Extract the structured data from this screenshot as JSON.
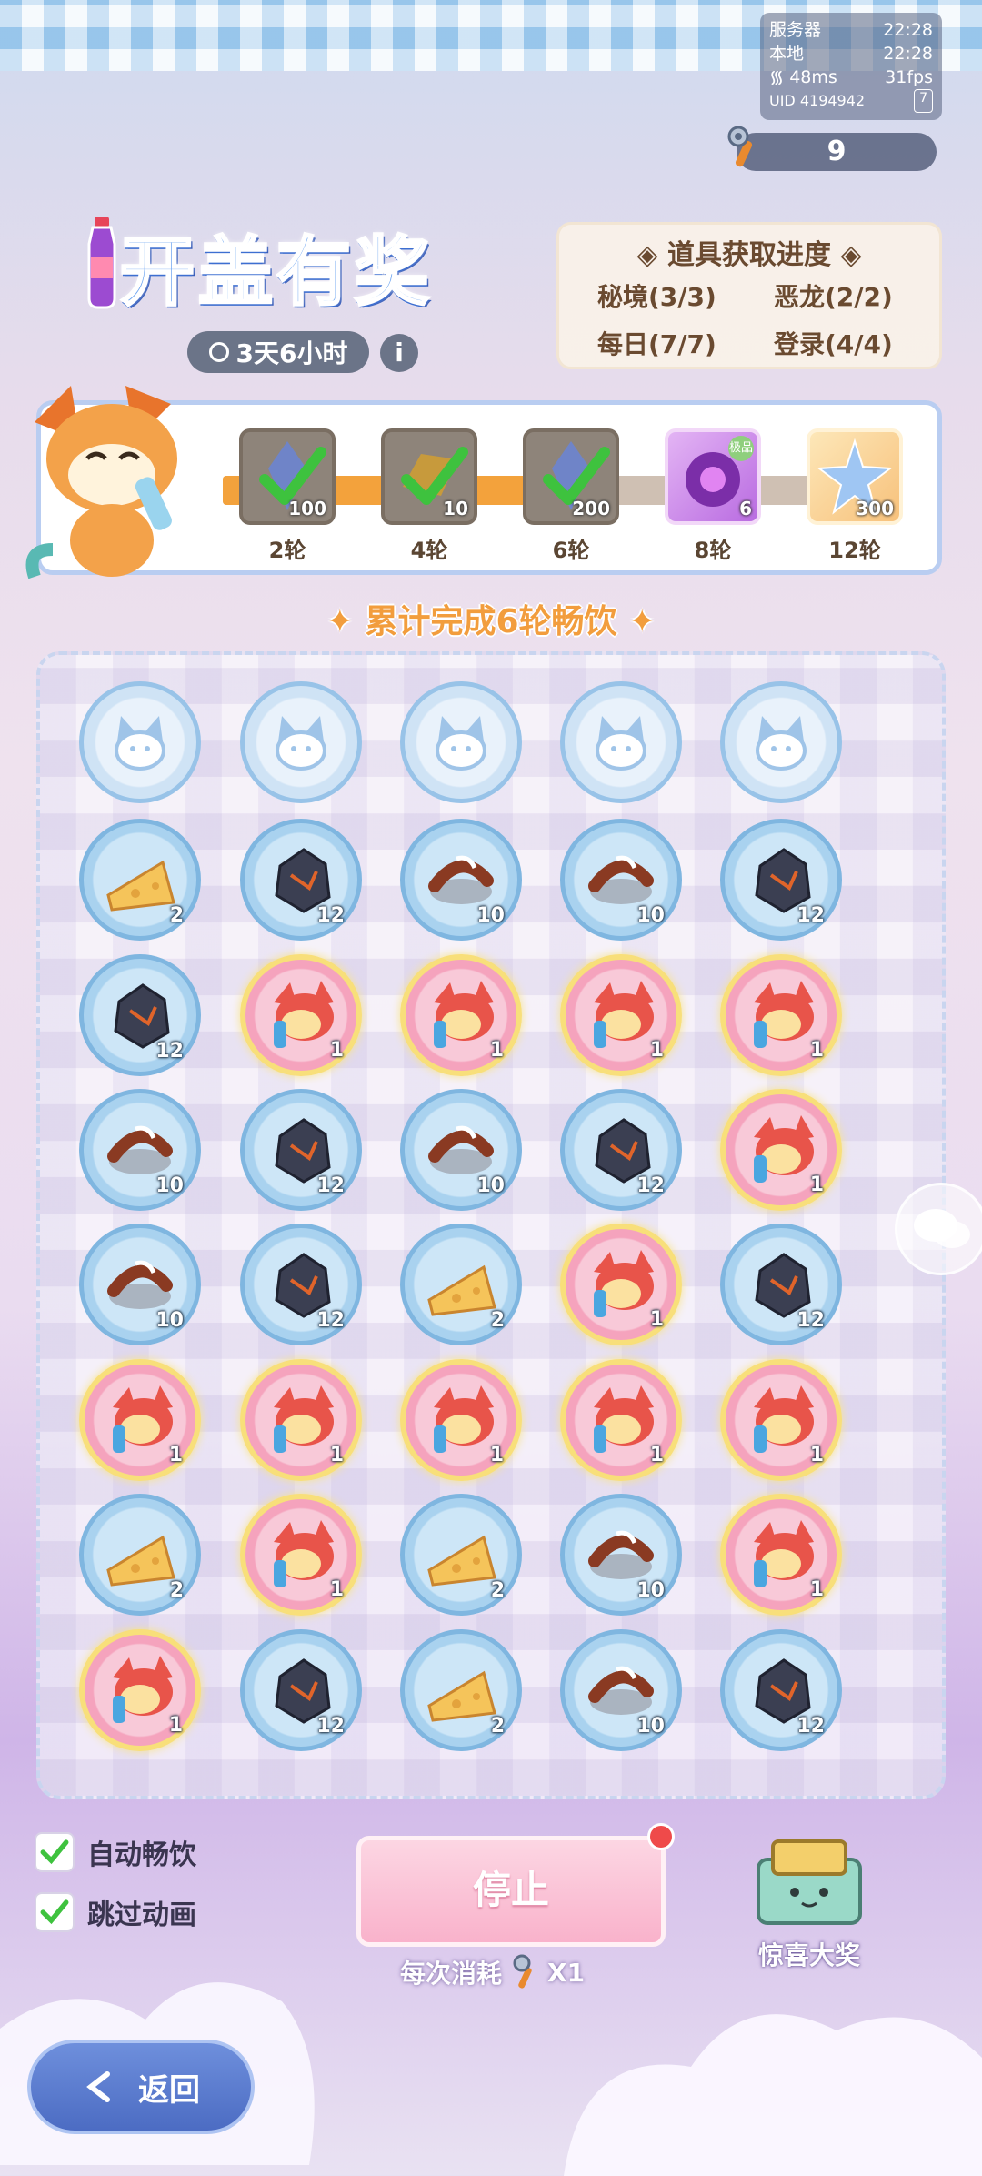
{
  "status": {
    "server_label": "服务器",
    "server_time": "22:28",
    "local_label": "本地",
    "local_time": "22:28",
    "ping": "48ms",
    "fps": "31fps",
    "uid": "UID 4194942",
    "badge": "7"
  },
  "opener_count": "9",
  "title": "开盖有奖",
  "timer": "3天6小时",
  "info": "i",
  "progress": {
    "title": "道具获取进度",
    "items": [
      "秘境(3/3)",
      "恶龙(2/2)",
      "每日(7/7)",
      "登录(4/4)"
    ]
  },
  "rewards": {
    "fill_fraction": 0.56,
    "tiers": [
      {
        "label": "2轮",
        "qty": "100",
        "claimed": true,
        "icon": "blue-crystal-icon"
      },
      {
        "label": "4轮",
        "qty": "10",
        "claimed": true,
        "icon": "gold-ingot-icon"
      },
      {
        "label": "6轮",
        "qty": "200",
        "claimed": true,
        "icon": "blue-crystal-icon"
      },
      {
        "label": "8轮",
        "qty": "6",
        "claimed": false,
        "icon": "purple-orb-icon",
        "tag": "极品"
      },
      {
        "label": "12轮",
        "qty": "300",
        "claimed": false,
        "icon": "star-crystal-icon"
      }
    ]
  },
  "cumulative_text": "累计完成6轮畅饮",
  "grid": [
    [
      {
        "t": "cap"
      },
      {
        "t": "cap"
      },
      {
        "t": "cap"
      },
      {
        "t": "cap"
      },
      {
        "t": "cap"
      }
    ],
    [
      {
        "t": "cheese",
        "q": "2"
      },
      {
        "t": "ore",
        "q": "12"
      },
      {
        "t": "sausage",
        "q": "10"
      },
      {
        "t": "sausage",
        "q": "10"
      },
      {
        "t": "ore",
        "q": "12"
      }
    ],
    [
      {
        "t": "ore",
        "q": "12"
      },
      {
        "t": "fox",
        "q": "1"
      },
      {
        "t": "fox",
        "q": "1"
      },
      {
        "t": "fox",
        "q": "1"
      },
      {
        "t": "fox",
        "q": "1"
      }
    ],
    [
      {
        "t": "sausage",
        "q": "10"
      },
      {
        "t": "ore",
        "q": "12"
      },
      {
        "t": "sausage",
        "q": "10"
      },
      {
        "t": "ore",
        "q": "12"
      },
      {
        "t": "fox",
        "q": "1"
      }
    ],
    [
      {
        "t": "sausage",
        "q": "10"
      },
      {
        "t": "ore",
        "q": "12"
      },
      {
        "t": "cheese",
        "q": "2"
      },
      {
        "t": "fox",
        "q": "1"
      },
      {
        "t": "ore",
        "q": "12"
      }
    ],
    [
      {
        "t": "fox",
        "q": "1"
      },
      {
        "t": "fox",
        "q": "1"
      },
      {
        "t": "fox",
        "q": "1"
      },
      {
        "t": "fox",
        "q": "1"
      },
      {
        "t": "fox",
        "q": "1"
      }
    ],
    [
      {
        "t": "cheese",
        "q": "2"
      },
      {
        "t": "fox",
        "q": "1"
      },
      {
        "t": "cheese",
        "q": "2"
      },
      {
        "t": "sausage",
        "q": "10"
      },
      {
        "t": "fox",
        "q": "1"
      }
    ],
    [
      {
        "t": "fox",
        "q": "1"
      },
      {
        "t": "ore",
        "q": "12"
      },
      {
        "t": "cheese",
        "q": "2"
      },
      {
        "t": "sausage",
        "q": "10"
      },
      {
        "t": "ore",
        "q": "12"
      }
    ]
  ],
  "options": {
    "auto_drink": "自动畅饮",
    "auto_drink_checked": true,
    "skip_anim": "跳过动画",
    "skip_anim_checked": true
  },
  "stop_label": "停止",
  "cost_label": "每次消耗",
  "cost_qty": "X1",
  "surprise_label": "惊喜大奖",
  "back_label": "返回"
}
